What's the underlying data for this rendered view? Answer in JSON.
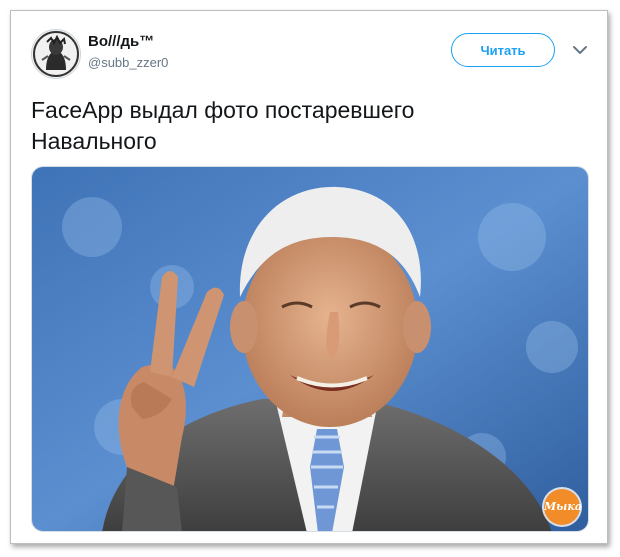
{
  "tweet": {
    "author_name": "Во///дь™",
    "author_handle": "@subb_zzer0",
    "follow_label": "Читать",
    "text": "FaceApp выдал фото постаревшего\nНавального"
  },
  "media": {
    "watermark_text": "Mыка"
  },
  "icons": {
    "caret": "chevron-down-icon",
    "avatar": "avatar-portrait"
  },
  "colors": {
    "accent": "#1da1f2",
    "text": "#14171a",
    "muted": "#657786",
    "watermark": "#f28c28"
  }
}
